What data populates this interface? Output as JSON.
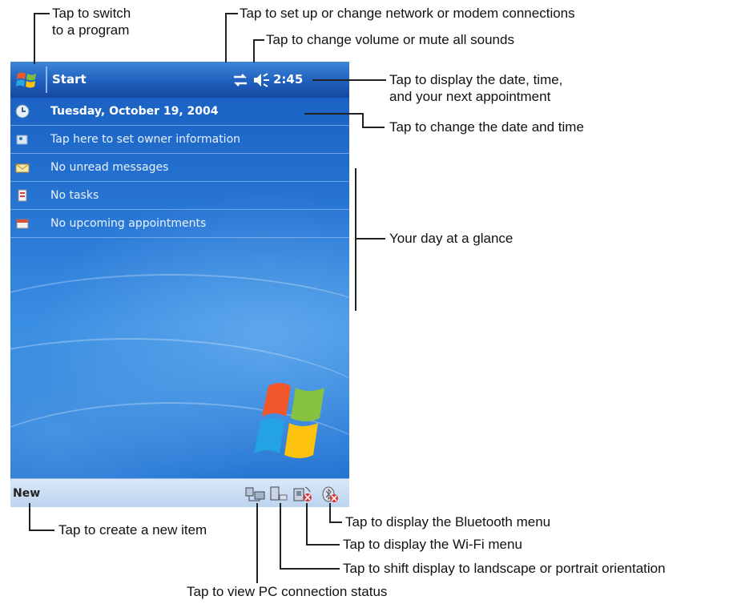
{
  "title_bar": {
    "start_label": "Start",
    "clock": "2:45"
  },
  "today_items": [
    {
      "text": "Tuesday, October 19, 2004",
      "icon": "clock-icon"
    },
    {
      "text": "Tap here to set owner information",
      "icon": "owner-icon"
    },
    {
      "text": "No unread messages",
      "icon": "messages-icon"
    },
    {
      "text": "No tasks",
      "icon": "tasks-icon"
    },
    {
      "text": "No upcoming appointments",
      "icon": "calendar-icon"
    }
  ],
  "menu_bar": {
    "new_label": "New",
    "tray_icons": [
      "pc-connection-icon",
      "orientation-icon",
      "wifi-icon",
      "bluetooth-icon"
    ]
  },
  "callouts": {
    "switch_program": "Tap to switch\nto a program",
    "network": "Tap to set up or change network or modem connections",
    "volume": "Tap to change volume or mute all sounds",
    "date_time_display": "Tap to display the date, time,\nand your next appointment",
    "change_date": "Tap to change the date and time",
    "day_glance": "Your day at a glance",
    "new_item": "Tap to create a new item",
    "bluetooth": "Tap to display the Bluetooth menu",
    "wifi": "Tap to display the Wi-Fi menu",
    "orientation": "Tap to shift display to landscape or portrait orientation",
    "pc_connection": "Tap to view PC connection status"
  }
}
